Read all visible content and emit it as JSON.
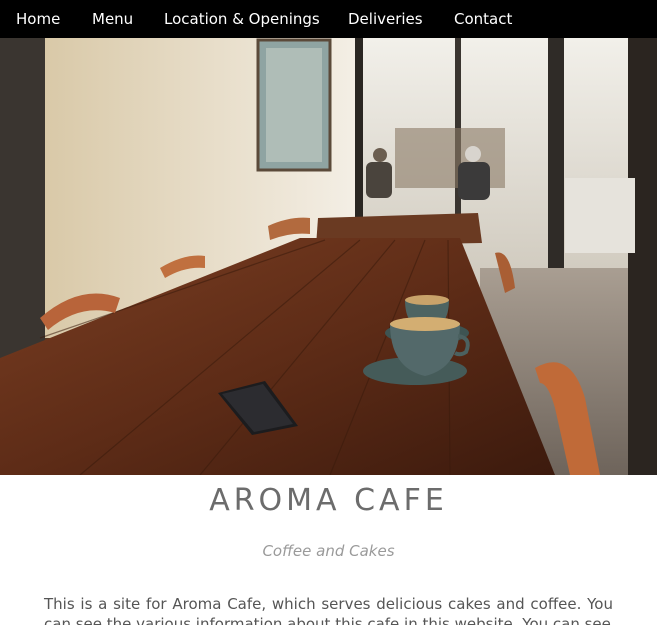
{
  "nav": {
    "items": [
      {
        "label": "Home"
      },
      {
        "label": "Menu"
      },
      {
        "label": "Location & Openings"
      },
      {
        "label": "Deliveries"
      },
      {
        "label": "Contact"
      }
    ]
  },
  "hero": {
    "image_icon": "cafe-interior-photo"
  },
  "main": {
    "title": "AROMA CAFE",
    "subtitle": "Coffee and Cakes",
    "intro": "This is a site for Aroma Cafe, which serves delicious cakes and coffee. You can see the various information about this cafe in this website. You can see"
  },
  "colors": {
    "nav_bg": "#000000",
    "nav_text": "#ffffff",
    "title": "#6c6c6c",
    "subtitle": "#9a9a9a",
    "body_text": "#555555"
  }
}
